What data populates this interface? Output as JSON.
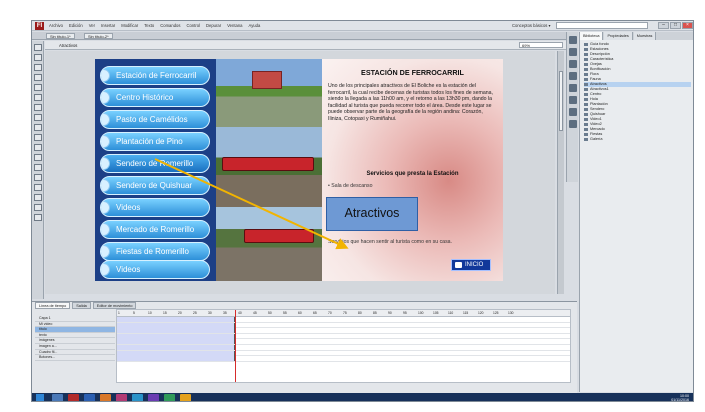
{
  "titlebar": {
    "menu": [
      "Archivo",
      "Edición",
      "Ver",
      "Insertar",
      "Modificar",
      "Texto",
      "Comandos",
      "Control",
      "Depurar",
      "Ventana",
      "Ayuda"
    ],
    "workspace": "Conceptos básicos ▾"
  },
  "doc_tabs": [
    "Sin título-1*",
    "Sin título-2*"
  ],
  "scene": {
    "name": "Atractivos",
    "zoom": "69%"
  },
  "nav_buttons": [
    "Estación de Ferrocarril",
    "Centro Histórico",
    "Pasto de Camélidos",
    "Plantación de Pino",
    "Sendero de Romerillo",
    "Sendero de Quishuar",
    "Videos",
    "Mercado de Romerillo",
    "Fiestas de Romerillo",
    "Videos"
  ],
  "content": {
    "title": "ESTACIÓN DE FERROCARRIL",
    "body": "Uno de los principales atractivos de El Boliche es la estación del ferrocarril, la cual recibe decenas de turistas todos los fines de semana, siendo la llegada a las 11h00 am, y el retorno a las 13h30 pm, dando la facilidad al turista que pueda recorrer todo el área. Desde este lugar se puede observar parte de la geografía de la región andina: Corazón, Iliniza, Cotopaxi y Rumiñahui.",
    "services_title": "Servicios que presta la Estación",
    "service_line": "• Sala de descanso",
    "overlay_button": "Atractivos",
    "bottom_text": "Servicios que hacen sentir al turista como en su casa.",
    "home_button": "INICIO"
  },
  "library": {
    "tabs": [
      "Biblioteca",
      "Propiedades",
      "Muestras"
    ],
    "items": [
      "Guía fondo",
      "Estaciones",
      "Descripción",
      "Característica",
      "Ovejas",
      "Bonificación",
      "Flora",
      "Fauna",
      "Atractivos",
      "Atractivos1",
      "Centro",
      "Hola",
      "Plantación",
      "Sendero",
      "Quishuar",
      "Video1",
      "Video2",
      "Mercado",
      "Fiestas",
      "Galería"
    ],
    "selected_index": 8
  },
  "timeline": {
    "tabs": [
      "Línea de tiempo",
      "Salida",
      "Editor de movimiento"
    ],
    "layers": [
      "Capa 1",
      "Mi video",
      "título",
      "texto",
      "imágenes",
      "imagen a...",
      "Cuadro fil...",
      "Botones..."
    ],
    "selected_layer_index": 2,
    "frame_numbers": [
      "1",
      "5",
      "10",
      "15",
      "20",
      "25",
      "30",
      "35",
      "40",
      "45",
      "50",
      "55",
      "60",
      "65",
      "70",
      "75",
      "80",
      "85",
      "90",
      "95",
      "100",
      "105",
      "110",
      "115",
      "120",
      "125",
      "130"
    ]
  },
  "taskbar": {
    "clock_time": "10:00",
    "clock_date": "01/11/2016"
  },
  "colors": {
    "nav_bg": "#1c3f86",
    "nav_button": "#2d8fd8",
    "overlay_button": "#6e99d4",
    "arrow": "#f2b400",
    "playhead": "#d62c2c"
  }
}
